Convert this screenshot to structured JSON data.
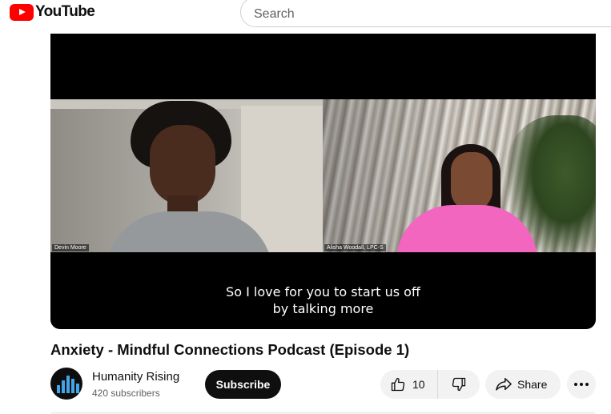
{
  "header": {
    "logo_text": "YouTube",
    "search_placeholder": "Search"
  },
  "video": {
    "participants": [
      "Devin Moore",
      "Alisha Woodall, LPC-S"
    ],
    "caption_lines": [
      "So I love for you to start us off",
      "by talking more"
    ]
  },
  "title": "Anxiety - Mindful Connections Podcast (Episode 1)",
  "channel": {
    "name": "Humanity Rising",
    "subscribers": "420 subscribers"
  },
  "actions": {
    "subscribe_label": "Subscribe",
    "like_count": "10",
    "share_label": "Share"
  },
  "colors": {
    "brand": "#ff0000",
    "button_dark": "#0f0f0f",
    "pill_bg": "#f2f2f2"
  },
  "icons": [
    "youtube-logo-icon",
    "thumbs-up-icon",
    "thumbs-down-icon",
    "share-arrow-icon",
    "more-dots-icon"
  ]
}
